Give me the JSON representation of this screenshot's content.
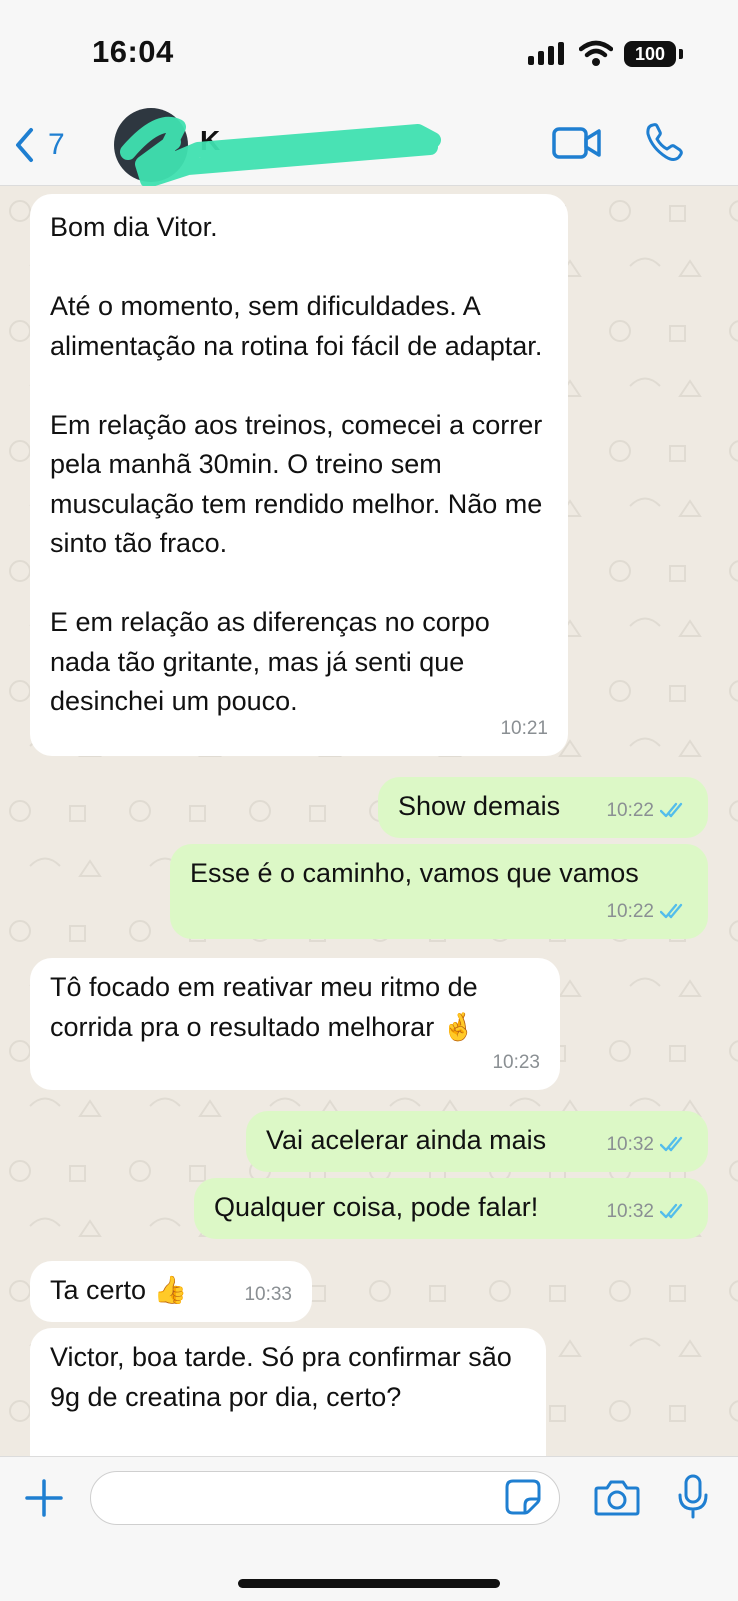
{
  "status": {
    "time": "16:04",
    "battery": "100"
  },
  "header": {
    "back_count": "7",
    "contact_name": "K"
  },
  "messages": [
    {
      "dir": "in",
      "text": "Bom dia Vitor.\n\nAté o momento, sem dificuldades. A alimentação na rotina foi fácil de adaptar.\n\nEm relação aos treinos, comecei a correr pela manhã 30min. O treino sem musculação tem rendido melhor. Não me sinto tão fraco.\n\nE em relação as diferenças no corpo nada tão gritante, mas já senti que desinchei um pouco.",
      "time": "10:21"
    },
    {
      "dir": "out",
      "text": "Show demais",
      "time": "10:22",
      "status": "read"
    },
    {
      "dir": "out",
      "text": "Esse é o caminho, vamos que vamos",
      "time": "10:22",
      "status": "read"
    },
    {
      "dir": "in",
      "text": "Tô focado em reativar meu ritmo de corrida pra o resultado melhorar 🤞",
      "time": "10:23"
    },
    {
      "dir": "out",
      "text": "Vai acelerar ainda mais",
      "time": "10:32",
      "status": "read"
    },
    {
      "dir": "out",
      "text": "Qualquer coisa, pode falar!",
      "time": "10:32",
      "status": "read"
    },
    {
      "dir": "in",
      "text": "Ta certo 👍",
      "time": "10:33"
    },
    {
      "dir": "in",
      "text": "Victor, boa tarde. Só pra confirmar são 9g de creatina por dia, certo?",
      "time": ""
    }
  ],
  "composer": {
    "placeholder": ""
  },
  "colors": {
    "accent": "#1f7fd1",
    "incoming": "#ffffff",
    "outgoing": "#dcf8c6",
    "chat_bg": "#efeae2",
    "read_ticks": "#53bdeb"
  },
  "icons": [
    "back-chevron-icon",
    "video-call-icon",
    "phone-icon",
    "plus-icon",
    "sticker-icon",
    "camera-icon",
    "microphone-icon",
    "read-receipt-icon"
  ]
}
